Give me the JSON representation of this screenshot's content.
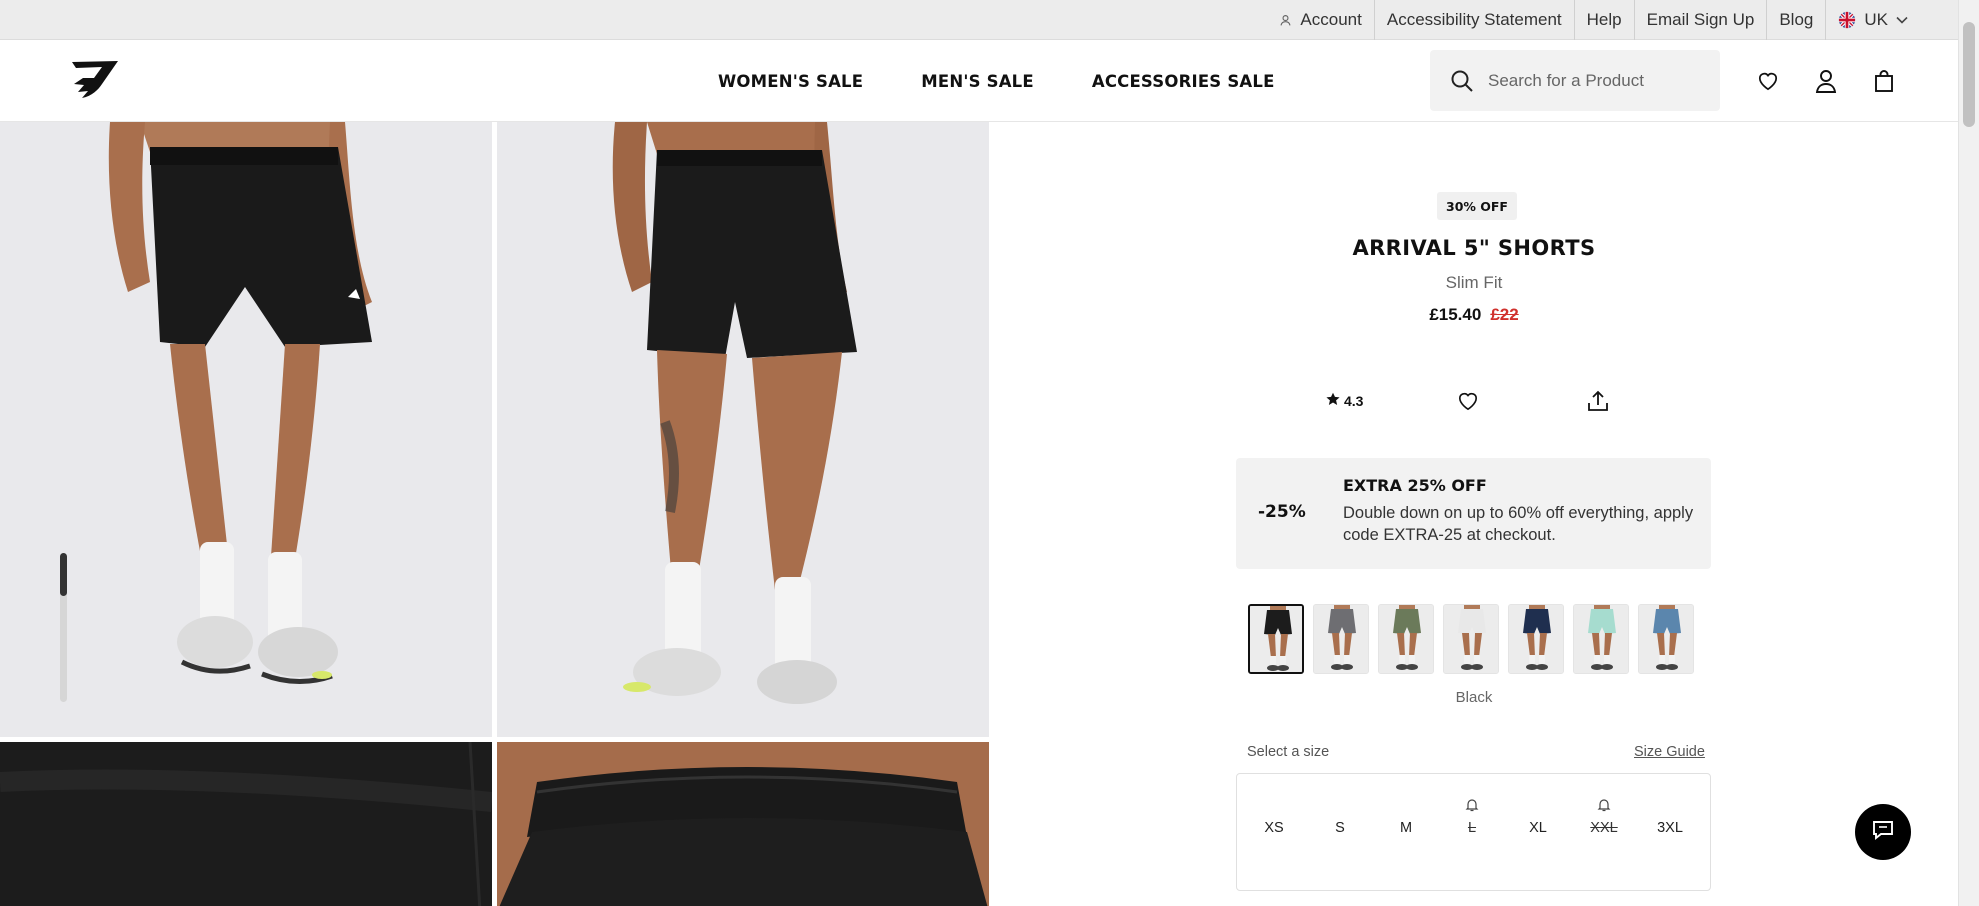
{
  "utility_bar": {
    "links": [
      {
        "label": "Account"
      },
      {
        "label": "Accessibility Statement"
      },
      {
        "label": "Help"
      },
      {
        "label": "Email Sign Up"
      },
      {
        "label": "Blog"
      },
      {
        "label": "UK"
      }
    ]
  },
  "header": {
    "nav": [
      {
        "label": "WOMEN'S SALE"
      },
      {
        "label": "MEN'S SALE"
      },
      {
        "label": "ACCESSORIES SALE"
      }
    ],
    "search_placeholder": "Search for a Product",
    "icons": [
      "heart-icon",
      "user-icon",
      "bag-icon"
    ]
  },
  "product": {
    "badge": "30% OFF",
    "title": "ARRIVAL 5\" SHORTS",
    "fit": "Slim Fit",
    "price": "£15.40",
    "original_price": "£22",
    "rating": "4.3",
    "promo": {
      "percent": "-25%",
      "title": "EXTRA 25% OFF",
      "text": "Double down on up to 60% off everything, apply code EXTRA-25 at checkout."
    },
    "swatch_colors": [
      "#1c1c1c",
      "#6e6e72",
      "#6b7a5a",
      "#e8e8e8",
      "#1f2f4f",
      "#a6dccf",
      "#5b86ad"
    ],
    "selected_color": "Black",
    "size_label": "Select a size",
    "size_guide": "Size Guide",
    "sizes": [
      {
        "label": "XS",
        "available": true
      },
      {
        "label": "S",
        "available": true
      },
      {
        "label": "M",
        "available": true
      },
      {
        "label": "L",
        "available": false
      },
      {
        "label": "XL",
        "available": true
      },
      {
        "label": "XXL",
        "available": false
      },
      {
        "label": "3XL",
        "available": true
      }
    ]
  },
  "colors": {
    "accent_sale": "#d0312d",
    "text": "#111111",
    "utility_bg": "#ececec"
  }
}
